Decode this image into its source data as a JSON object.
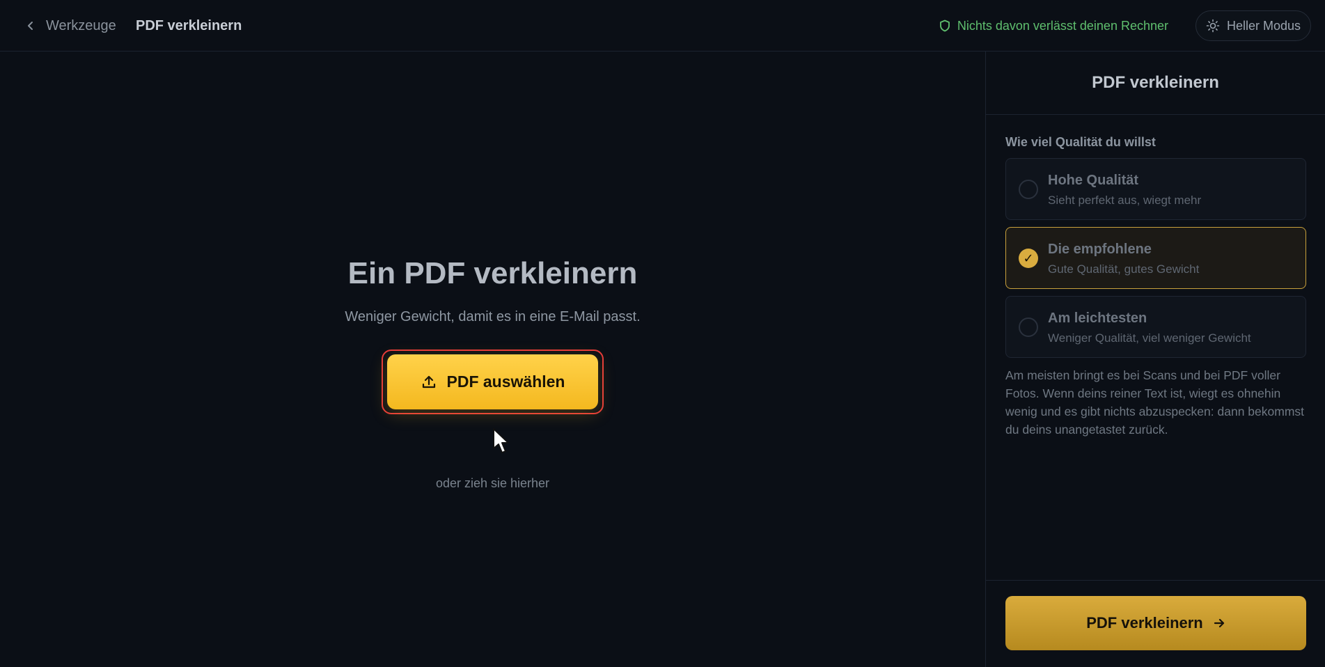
{
  "header": {
    "back_label": "Werkzeuge",
    "title": "PDF verkleinern",
    "privacy_text": "Nichts davon verlässt deinen Rechner",
    "theme_toggle_label": "Heller Modus"
  },
  "main": {
    "title": "Ein PDF verkleinern",
    "subtitle": "Weniger Gewicht, damit es in eine E-Mail passt.",
    "upload_button_label": "PDF auswählen",
    "drop_hint": "oder zieh sie hierher"
  },
  "panel": {
    "title": "PDF verkleinern",
    "options_label": "Wie viel Qualität du willst",
    "options": [
      {
        "title": "Hohe Qualität",
        "description": "Sieht perfekt aus, wiegt mehr",
        "selected": false
      },
      {
        "title": "Die empfohlene",
        "description": "Gute Qualität, gutes Gewicht",
        "selected": true
      },
      {
        "title": "Am leichtesten",
        "description": "Weniger Qualität, viel weniger Gewicht",
        "selected": false
      }
    ],
    "note": "Am meisten bringt es bei Scans und bei PDF voller Fotos. Wenn deins reiner Text ist, wiegt es ohnehin wenig und es gibt nichts abzuspecken: dann bekommst du deins unangetastet zurück.",
    "submit_label": "PDF verkleinern",
    "check_glyph": "✓"
  },
  "colors": {
    "accent": "#f4b81f",
    "privacy_green": "#5fbf6e",
    "highlight_ring": "#e53a3a"
  },
  "icons": {
    "back": "chevron-left-icon",
    "privacy": "shield-icon",
    "theme": "sun-icon",
    "upload": "upload-icon",
    "submit": "arrow-right-icon",
    "cursor": "mouse-pointer-icon"
  }
}
